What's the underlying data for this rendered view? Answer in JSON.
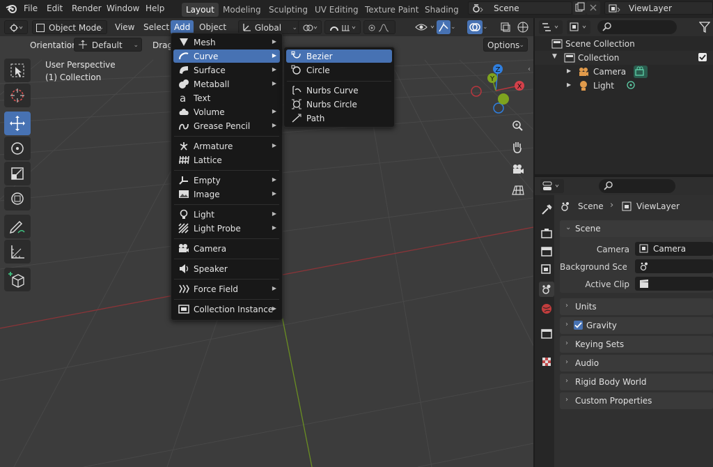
{
  "topbar": {
    "menus": [
      "File",
      "Edit",
      "Render",
      "Window",
      "Help"
    ],
    "workspaces": [
      "Layout",
      "Modeling",
      "Sculpting",
      "UV Editing",
      "Texture Paint",
      "Shading"
    ],
    "active_workspace": "Layout",
    "scene_name": "Scene",
    "view_layer_name": "ViewLayer"
  },
  "viewport_header": {
    "mode": "Object Mode",
    "menus": [
      "View",
      "Select",
      "Add",
      "Object"
    ],
    "active_menu": "Add",
    "transform_orientation": "Global"
  },
  "tool_settings": {
    "orientation_label": "Orientation:",
    "orientation_value": "Default",
    "drag_label": "Drag:",
    "options_label": "Options"
  },
  "viewport_overlay": {
    "perspective": "User Perspective",
    "collection": "(1) Collection"
  },
  "gizmo": {
    "x": "X",
    "y": "Y",
    "z": "Z"
  },
  "add_menu": {
    "items": [
      {
        "label": "Mesh",
        "icon": "mesh-icon",
        "submenu": true
      },
      {
        "label": "Curve",
        "icon": "curve-icon",
        "submenu": true,
        "highlighted": true
      },
      {
        "label": "Surface",
        "icon": "surface-icon",
        "submenu": true
      },
      {
        "label": "Metaball",
        "icon": "metaball-icon",
        "submenu": true
      },
      {
        "label": "Text",
        "icon": "text-icon",
        "submenu": false
      },
      {
        "label": "Volume",
        "icon": "volume-icon",
        "submenu": true
      },
      {
        "label": "Grease Pencil",
        "icon": "grease-pencil-icon",
        "submenu": true
      },
      {
        "label": "Armature",
        "icon": "armature-icon",
        "submenu": true
      },
      {
        "label": "Lattice",
        "icon": "lattice-icon",
        "submenu": false
      },
      {
        "label": "Empty",
        "icon": "empty-icon",
        "submenu": true
      },
      {
        "label": "Image",
        "icon": "image-icon",
        "submenu": true
      },
      {
        "label": "Light",
        "icon": "light-icon",
        "submenu": true
      },
      {
        "label": "Light Probe",
        "icon": "light-probe-icon",
        "submenu": true
      },
      {
        "label": "Camera",
        "icon": "camera-icon",
        "submenu": false
      },
      {
        "label": "Speaker",
        "icon": "speaker-icon",
        "submenu": false
      },
      {
        "label": "Force Field",
        "icon": "force-field-icon",
        "submenu": true
      },
      {
        "label": "Collection Instance",
        "icon": "collection-instance-icon",
        "submenu": true
      }
    ]
  },
  "curve_submenu": {
    "items": [
      {
        "label": "Bezier",
        "icon": "bezier-icon",
        "highlighted": true
      },
      {
        "label": "Circle",
        "icon": "circle-icon"
      },
      {
        "label": "Nurbs Curve",
        "icon": "nurbs-curve-icon"
      },
      {
        "label": "Nurbs Circle",
        "icon": "nurbs-circle-icon"
      },
      {
        "label": "Path",
        "icon": "path-icon"
      }
    ]
  },
  "outliner": {
    "scene_collection": "Scene Collection",
    "collection": "Collection",
    "objects": [
      "Camera",
      "Light"
    ]
  },
  "properties": {
    "breadcrumb_scene": "Scene",
    "breadcrumb_view_layer": "ViewLayer",
    "scene_panel_title": "Scene",
    "camera_label": "Camera",
    "camera_value": "Camera",
    "background_scene_label": "Background Scen",
    "active_clip_label": "Active Clip",
    "panels": [
      "Units",
      "Gravity",
      "Keying Sets",
      "Audio",
      "Rigid Body World",
      "Custom Properties"
    ],
    "gravity_checked": true
  },
  "colors": {
    "accent": "#4772b3",
    "x_axis": "#b8363e",
    "y_axis": "#6f9a1c",
    "z_axis": "#2f7fe0",
    "viewport_bg": "#3c3c3c"
  }
}
